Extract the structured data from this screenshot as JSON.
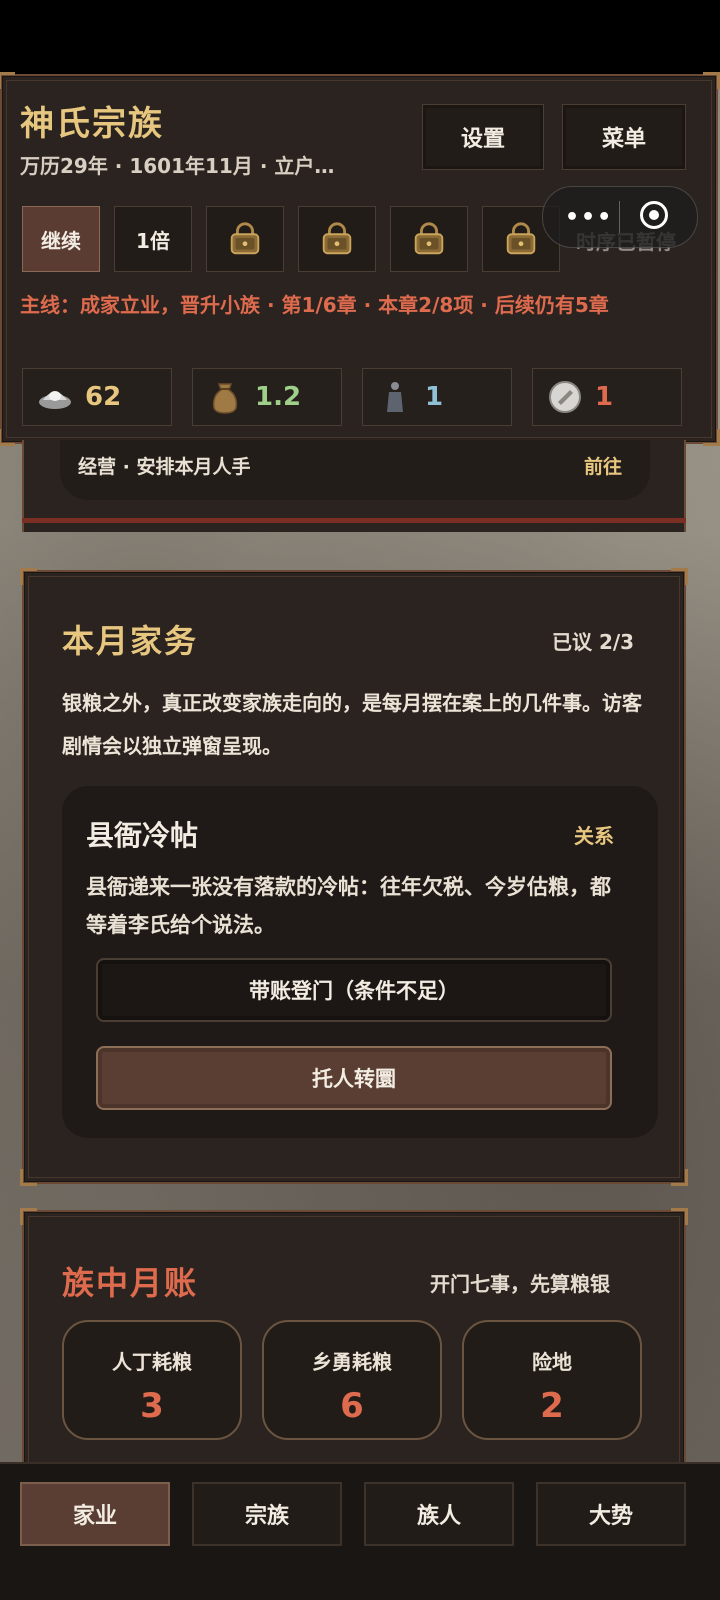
{
  "header": {
    "clan_name": "神氏宗族",
    "date_line": "万历29年 · 1601年11月 · 立户…",
    "settings_label": "设置",
    "menu_label": "菜单",
    "continue_label": "继续",
    "speed_label": "1倍",
    "locked_icons": [
      "lock-icon",
      "lock-icon",
      "lock-icon",
      "lock-icon"
    ],
    "paused_text": "时序已暂停",
    "mainline": "主线：成家立业，晋升小族 · 第1/6章 · 本章2/8项 · 后续仍有5章"
  },
  "resources": [
    {
      "icon": "silver-ingot-icon",
      "value": "62",
      "color": "#e7c77f"
    },
    {
      "icon": "grain-sack-icon",
      "value": "1.2",
      "color": "#9fd08a"
    },
    {
      "icon": "person-icon",
      "value": "1",
      "color": "#8fc0d6"
    },
    {
      "icon": "token-icon",
      "value": "1",
      "color": "#de6b4e"
    }
  ],
  "strip": {
    "left": "经营 · 安排本月人手",
    "right": "前往"
  },
  "affairs": {
    "title": "本月家务",
    "progress": "已议 2/3",
    "description": "银粮之外，真正改变家族走向的，是每月摆在案上的几件事。访客剧情会以独立弹窗呈现。",
    "event": {
      "title": "县衙冷帖",
      "tag": "关系",
      "body": "县衙递来一张没有落款的冷帖：往年欠税、今岁估粮，都等着李氏给个说法。",
      "choice_disabled": "带账登门（条件不足）",
      "choice_primary": "托人转圜"
    }
  },
  "ledger": {
    "title": "族中月账",
    "subtitle": "开门七事，先算粮银",
    "items": [
      {
        "label": "人丁耗粮",
        "value": "3"
      },
      {
        "label": "乡勇耗粮",
        "value": "6"
      },
      {
        "label": "险地",
        "value": "2"
      }
    ]
  },
  "nav": [
    "家业",
    "宗族",
    "族人",
    "大势"
  ],
  "colors": {
    "accent_gold": "#e7c77f",
    "accent_red": "#de6b4e",
    "panel": "#2a231f",
    "active_button": "#5a3e33"
  }
}
